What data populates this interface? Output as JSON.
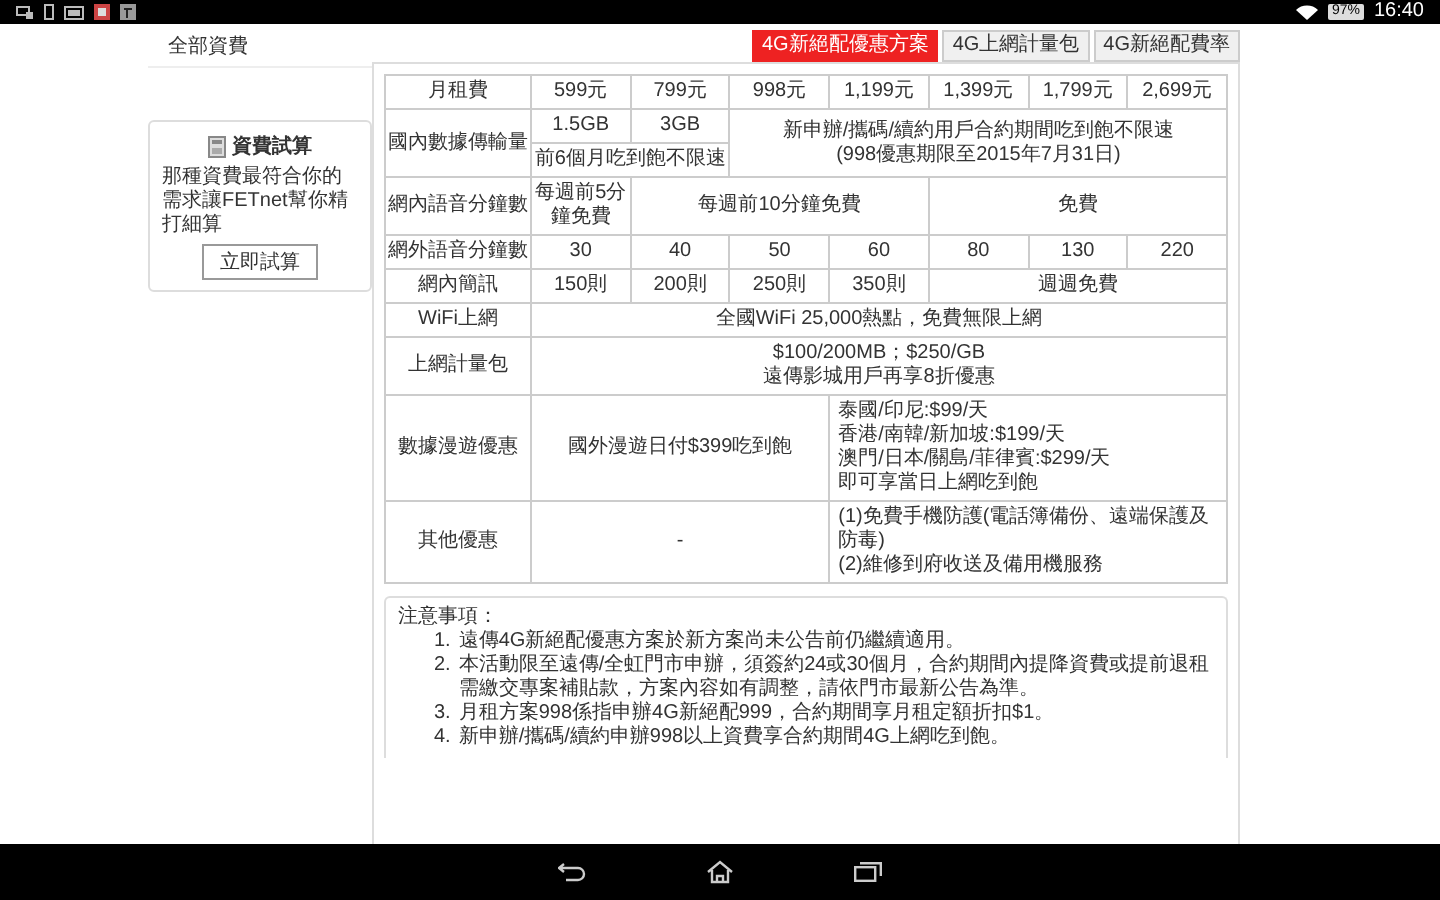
{
  "status_bar": {
    "battery": "97%",
    "time": "16:40"
  },
  "sidebar": {
    "heading": "全部資費",
    "calculator": {
      "title": "資費試算",
      "text": "那種資費最符合你的需求讓FETnet幫你精打細算",
      "button": "立即試算"
    }
  },
  "tabs": [
    {
      "label": "4G新絕配優惠方案",
      "selected": true
    },
    {
      "label": "4G上網計量包",
      "selected": false
    },
    {
      "label": "4G新絕配費率",
      "selected": false
    }
  ],
  "table": {
    "rows": [
      {
        "label": "月租費",
        "cells": [
          "599元",
          "799元",
          "998元",
          "1,199元",
          "1,399元",
          "1,799元",
          "2,699元"
        ]
      },
      {
        "label": "國內數據傳輸量",
        "cells": [
          "1.5GB",
          "3GB",
          {
            "text": [
              "新申辦/攜碼/續約用戶合約期間吃到飽不限速",
              "(998優惠期限至2015年7月31日)"
            ],
            "colspan": 5,
            "rowspan": 2
          }
        ]
      },
      {
        "cells": [
          {
            "text": "前6個月吃到飽不限速",
            "colspan": 2
          }
        ]
      },
      {
        "label": "網內語音分鐘數",
        "cells": [
          "每週前5分鐘免費",
          {
            "text": "每週前10分鐘免費",
            "colspan": 3
          },
          {
            "text": "免費",
            "colspan": 3
          }
        ]
      },
      {
        "label": "網外語音分鐘數",
        "cells": [
          "30",
          "40",
          "50",
          "60",
          "80",
          "130",
          "220"
        ]
      },
      {
        "label": "網內簡訊",
        "cells": [
          "150則",
          "200則",
          "250則",
          "350則",
          {
            "text": "週週免費",
            "colspan": 3
          }
        ]
      },
      {
        "label": "WiFi上網",
        "cells": [
          {
            "text": "全國WiFi 25,000熱點，免費無限上網",
            "colspan": 7
          }
        ]
      },
      {
        "label": "上網計量包",
        "cells": [
          {
            "text": [
              "$100/200MB；$250/GB",
              "遠傳影城用戶再享8折優惠"
            ],
            "colspan": 7
          }
        ]
      },
      {
        "label": "數據漫遊優惠",
        "cells": [
          {
            "text": "國外漫遊日付$399吃到飽",
            "colspan": 3
          },
          {
            "text": [
              "泰國/印尼:$99/天",
              "香港/南韓/新加坡:$199/天",
              "澳門/日本/關島/菲律賓:$299/天",
              "即可享當日上網吃到飽"
            ],
            "colspan": 4
          }
        ]
      },
      {
        "label": "其他優惠",
        "cells": [
          {
            "text": "-",
            "colspan": 3
          },
          {
            "text": [
              "(1)免費手機防護(電話簿備份、遠端保護及防毒)",
              "(2)維修到府收送及備用機服務"
            ],
            "colspan": 4
          }
        ]
      }
    ]
  },
  "notes": {
    "title": "注意事項：",
    "items": [
      {
        "number": "1.",
        "text": "遠傳4G新絕配優惠方案於新方案尚未公告前仍繼續適用。"
      },
      {
        "number": "2.",
        "text": "本活動限至遠傳/全虹門市申辦，須簽約24或30個月，合約期間內提降資費或提前退租需繳交專案補貼款，方案內容如有調整，請依門市最新公告為準。"
      },
      {
        "number": "3.",
        "text": "月租方案998係指申辦4G新絕配999，合約期間享月租定額折扣$1。"
      },
      {
        "number": "4.",
        "text": "新申辦/攜碼/續約申辦998以上資費享合約期間4G上網吃到飽。"
      }
    ]
  }
}
